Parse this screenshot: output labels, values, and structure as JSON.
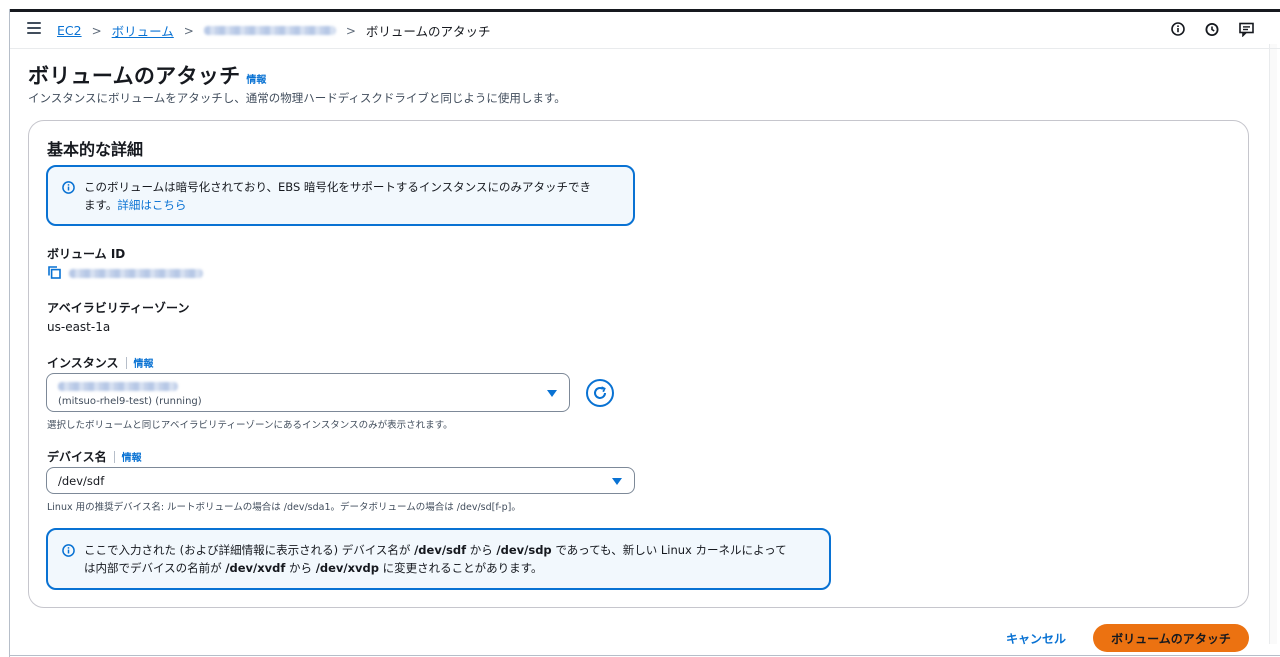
{
  "breadcrumb": {
    "root": "EC2",
    "volumes": "ボリューム",
    "current": "ボリュームのアタッチ"
  },
  "header": {
    "title": "ボリュームのアタッチ",
    "info_label": "情報",
    "description": "インスタンスにボリュームをアタッチし、通常の物理ハードディスクドライブと同じように使用します。"
  },
  "details": {
    "title": "基本的な詳細",
    "encryption_alert": {
      "line1": "このボリュームは暗号化されており、EBS 暗号化をサポートするインスタンスにのみアタッチでき",
      "line2": "ます。",
      "link": "詳細はこちら"
    },
    "volume_id_label": "ボリューム ID",
    "az_label": "アベイラビリティーゾーン",
    "az_value": "us-east-1a",
    "instance": {
      "label": "インスタンス",
      "info": "情報",
      "selected_sub": "(mitsuo-rhel9-test) (running)",
      "hint": "選択したボリュームと同じアベイラビリティーゾーンにあるインスタンスのみが表示されます。"
    },
    "device": {
      "label": "デバイス名",
      "info": "情報",
      "value": "/dev/sdf",
      "hint": "Linux 用の推奨デバイス名: ルートボリュームの場合は /dev/sda1。データボリュームの場合は /dev/sd[f-p]。"
    },
    "device_alert": {
      "l1_a": "ここで入力された (および詳細情報に表示される) デバイス名が ",
      "l1_b": "/dev/sdf",
      "l1_c": " から ",
      "l1_d": "/dev/sdp",
      "l1_e": " であっても、新しい Linux カーネルによって",
      "l2_a": "は内部でデバイスの名前が ",
      "l2_b": "/dev/xvdf",
      "l2_c": " から ",
      "l2_d": "/dev/xvdp",
      "l2_e": " に変更されることがあります。"
    }
  },
  "actions": {
    "cancel": "キャンセル",
    "attach": "ボリュームのアタッチ"
  },
  "colors": {
    "link": "#0972d3",
    "primary": "#ec7211",
    "alert_bg": "#f2f8fd"
  }
}
